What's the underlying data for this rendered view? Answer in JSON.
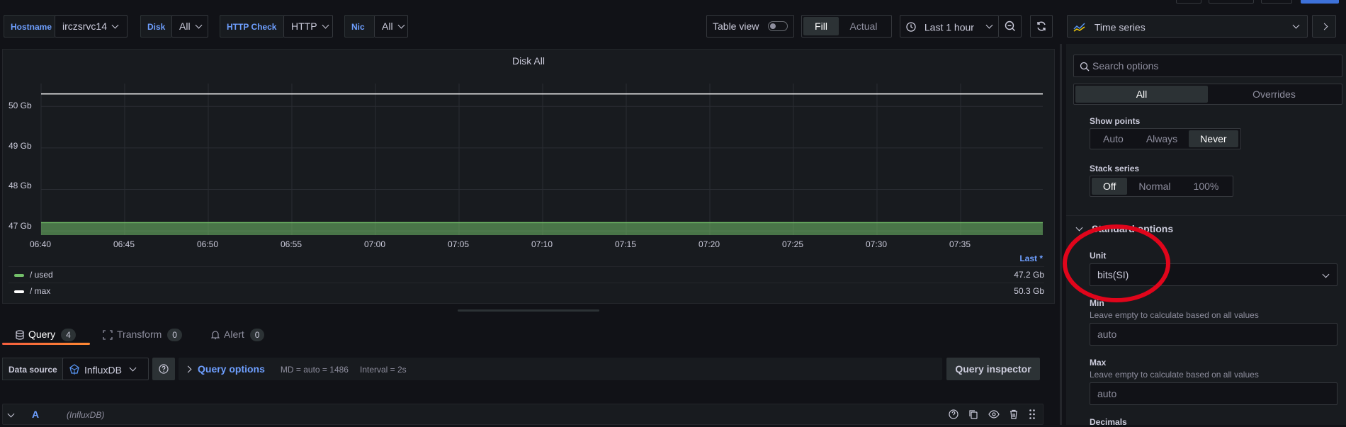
{
  "variables": [
    {
      "label": "Hostname",
      "value": "irczsrvc14"
    },
    {
      "label": "Disk",
      "value": "All"
    },
    {
      "label": "HTTP Check",
      "value": "HTTP"
    },
    {
      "label": "Nic",
      "value": "All"
    }
  ],
  "toolbar": {
    "table_view": "Table view",
    "fill": "Fill",
    "actual": "Actual",
    "time_range": "Last 1 hour"
  },
  "viz_picker": {
    "label": "Time series"
  },
  "panel": {
    "title": "Disk All",
    "y_ticks": [
      "50 Gb",
      "49 Gb",
      "48 Gb",
      "47 Gb"
    ],
    "x_ticks": [
      "06:40",
      "06:45",
      "06:50",
      "06:55",
      "07:00",
      "07:05",
      "07:10",
      "07:15",
      "07:20",
      "07:25",
      "07:30",
      "07:35"
    ],
    "legend_header": "Last *",
    "legend": [
      {
        "name": "/ used",
        "value": "47.2 Gb",
        "color": "#73bf69"
      },
      {
        "name": "/ max",
        "value": "50.3 Gb",
        "color": "#ffffff"
      }
    ]
  },
  "chart_data": {
    "type": "area",
    "title": "Disk All",
    "x": [
      "06:40",
      "06:45",
      "06:50",
      "06:55",
      "07:00",
      "07:05",
      "07:10",
      "07:15",
      "07:20",
      "07:25",
      "07:30",
      "07:35"
    ],
    "series": [
      {
        "name": "/ used",
        "values": [
          47.2,
          47.2,
          47.2,
          47.2,
          47.2,
          47.2,
          47.2,
          47.2,
          47.2,
          47.2,
          47.2,
          47.2
        ],
        "color": "#73bf69"
      },
      {
        "name": "/ max",
        "values": [
          50.3,
          50.3,
          50.3,
          50.3,
          50.3,
          50.3,
          50.3,
          50.3,
          50.3,
          50.3,
          50.3,
          50.3
        ],
        "color": "#ffffff"
      }
    ],
    "ylim": [
      46.9,
      50.55
    ],
    "grid": true,
    "legend_position": "bottom"
  },
  "tabs": {
    "query": {
      "label": "Query",
      "count": "4"
    },
    "transform": {
      "label": "Transform",
      "count": "0"
    },
    "alert": {
      "label": "Alert",
      "count": "0"
    }
  },
  "query_row": {
    "data_source_label": "Data source",
    "data_source": "InfluxDB",
    "query_options": "Query options",
    "md": "MD = auto = 1486",
    "interval": "Interval = 2s",
    "inspector": "Query inspector"
  },
  "query_a": {
    "ref": "A",
    "source": "(InfluxDB)"
  },
  "options": {
    "search_placeholder": "Search options",
    "tab_all": "All",
    "tab_overrides": "Overrides",
    "show_points": {
      "label": "Show points",
      "options": [
        "Auto",
        "Always",
        "Never"
      ],
      "selected": "Never"
    },
    "stack_series": {
      "label": "Stack series",
      "options": [
        "Off",
        "Normal",
        "100%"
      ],
      "selected": "Off"
    },
    "standard_options": "Standard options",
    "unit": {
      "label": "Unit",
      "value": "bits(SI)"
    },
    "min": {
      "label": "Min",
      "desc": "Leave empty to calculate based on all values",
      "placeholder": "auto"
    },
    "max": {
      "label": "Max",
      "desc": "Leave empty to calculate based on all values",
      "placeholder": "auto"
    },
    "decimals": "Decimals"
  },
  "colors": {
    "accent": "#3d71d9",
    "link": "#6e9fff",
    "annotation": "#e0051b"
  }
}
